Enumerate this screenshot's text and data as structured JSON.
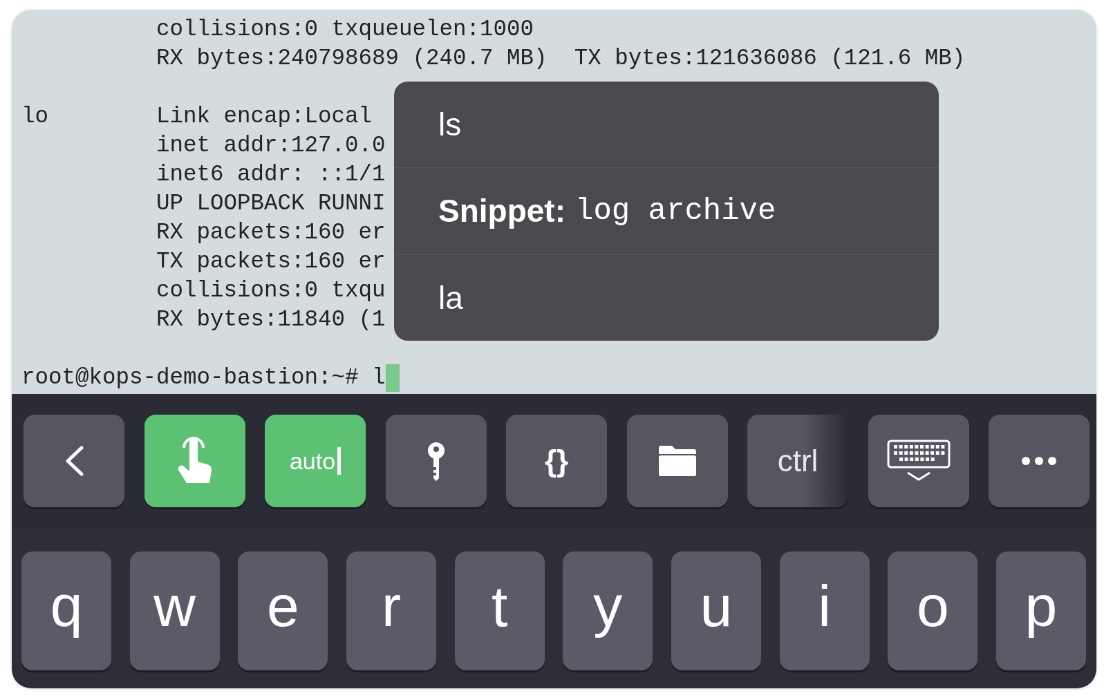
{
  "terminal": {
    "blocks": [
      {
        "lines": [
          "          collisions:0 txqueuelen:1000",
          "          RX bytes:240798689 (240.7 MB)  TX bytes:121636086 (121.6 MB)"
        ]
      },
      {
        "lines": [
          "lo        Link encap:Local",
          "          inet addr:127.0.0",
          "          inet6 addr: ::1/1",
          "          UP LOOPBACK RUNNI",
          "          RX packets:160 er",
          "          TX packets:160 er",
          "          collisions:0 txqu",
          "          RX bytes:11840 (1"
        ]
      }
    ],
    "prompt": "root@kops-demo-bastion:~# l"
  },
  "suggestions": [
    {
      "kind": "command",
      "text": "ls"
    },
    {
      "kind": "snippet",
      "label": "Snippet:",
      "text": "log archive"
    },
    {
      "kind": "command",
      "text": "la"
    }
  ],
  "toolbar": [
    {
      "kind": "back",
      "on": false
    },
    {
      "kind": "touch",
      "on": true
    },
    {
      "kind": "auto",
      "label": "auto",
      "on": true
    },
    {
      "kind": "key",
      "on": false
    },
    {
      "kind": "snippets",
      "label": "{}",
      "on": false
    },
    {
      "kind": "files",
      "on": false
    },
    {
      "kind": "ctrl",
      "label": "ctrl",
      "on": false
    },
    {
      "kind": "keyboard",
      "on": false
    },
    {
      "kind": "more",
      "on": false
    }
  ],
  "keyboard": {
    "keys": [
      "q",
      "w",
      "e",
      "r",
      "t",
      "y",
      "u",
      "i",
      "o",
      "p"
    ]
  }
}
